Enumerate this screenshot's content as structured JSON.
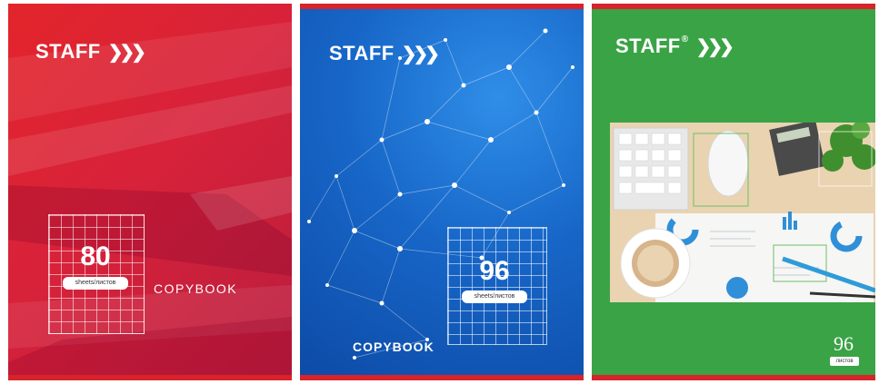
{
  "covers": [
    {
      "brand": "STAFF",
      "sheets_number": "80",
      "sheets_label": "sheets/листов",
      "product": "COPYBOOK"
    },
    {
      "brand": "STAFF",
      "sheets_number": "96",
      "sheets_label": "sheets/листов",
      "product": "COPYBOOK"
    },
    {
      "brand": "STAFF",
      "registered_mark": "®",
      "sheets_number": "96",
      "sheets_label": "листов"
    }
  ],
  "colors": {
    "red": "#e3252b",
    "blue": "#1766c7",
    "green": "#3aa346",
    "band": "#d8232a"
  },
  "icons": {
    "brand_chevrons": "brand-chevrons-icon"
  }
}
